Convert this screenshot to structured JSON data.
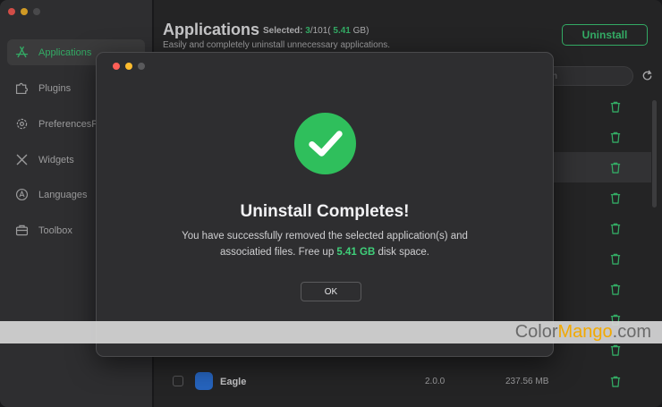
{
  "sidebar": {
    "items": [
      {
        "label": "Applications",
        "icon": "app-store-icon",
        "active": true
      },
      {
        "label": "Plugins",
        "icon": "puzzle-icon"
      },
      {
        "label": "PreferencesPanes",
        "icon": "gear-icon"
      },
      {
        "label": "Widgets",
        "icon": "tools-icon"
      },
      {
        "label": "Languages",
        "icon": "language-icon"
      },
      {
        "label": "Toolbox",
        "icon": "toolbox-icon"
      }
    ]
  },
  "header": {
    "title": "Applications",
    "selected_prefix": "Selected:",
    "selected_count": "3",
    "selected_total": "/101(",
    "selected_size": "5.41",
    "selected_unit": "GB)",
    "subtitle": "Easily and completely uninstall unnecessary applications.",
    "uninstall_label": "Uninstall",
    "search_text": "rch"
  },
  "list": {
    "visible_row": {
      "name": "Eagle",
      "version": "2.0.0",
      "size": "237.56 MB"
    }
  },
  "dialog": {
    "heading": "Uninstall Completes!",
    "message_part1": "You have successfully removed the selected application(s) and associatied files. Free up",
    "freed_size": "5.41 GB",
    "message_part2": "disk space.",
    "ok_label": "OK"
  },
  "watermark": {
    "part1": "Color",
    "part2": "Mango",
    "part3": ".com"
  },
  "colors": {
    "accent": "#3fd07a",
    "window": "#2c2c2e",
    "sidebar": "#39393b",
    "success": "#2fbf5c"
  }
}
